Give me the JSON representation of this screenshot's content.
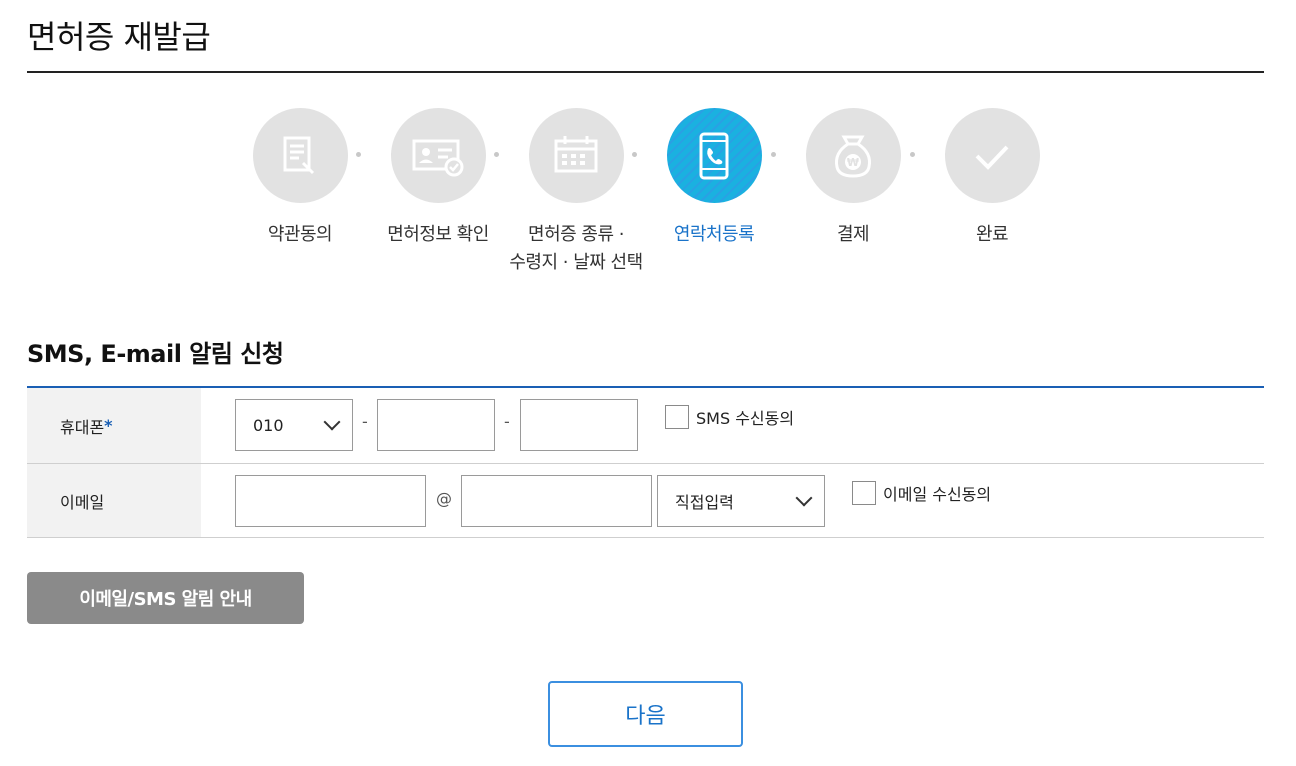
{
  "page": {
    "title": "면허증 재발급"
  },
  "steps": [
    {
      "label": "약관동의",
      "label2": "",
      "icon": "document-edit-icon",
      "active": false
    },
    {
      "label": "면허정보 확인",
      "label2": "",
      "icon": "id-card-check-icon",
      "active": false
    },
    {
      "label": "면허증 종류 ·",
      "label2": "수령지 · 날짜 선택",
      "icon": "calendar-icon",
      "active": false
    },
    {
      "label": "연락처등록",
      "label2": "",
      "icon": "mobile-phone-icon",
      "active": true
    },
    {
      "label": "결제",
      "label2": "",
      "icon": "money-bag-icon",
      "active": false
    },
    {
      "label": "완료",
      "label2": "",
      "icon": "checkmark-icon",
      "active": false
    }
  ],
  "section": {
    "title": "SMS, E-mail 알림 신청"
  },
  "form": {
    "phone": {
      "label": "휴대폰",
      "required_mark": "*",
      "prefix": "010",
      "separator": "-",
      "sms_consent_label": "SMS 수신동의"
    },
    "email": {
      "label": "이메일",
      "at_sign": "@",
      "domain_select": "직접입력",
      "email_consent_label": "이메일 수신동의"
    }
  },
  "buttons": {
    "notice": "이메일/SMS 알림 안내",
    "next": "다음"
  },
  "colors": {
    "accent": "#1a73c9",
    "active_step": "#1aa6e2",
    "table_border": "#1a5fb4",
    "inactive_step": "#e2e2e2"
  }
}
